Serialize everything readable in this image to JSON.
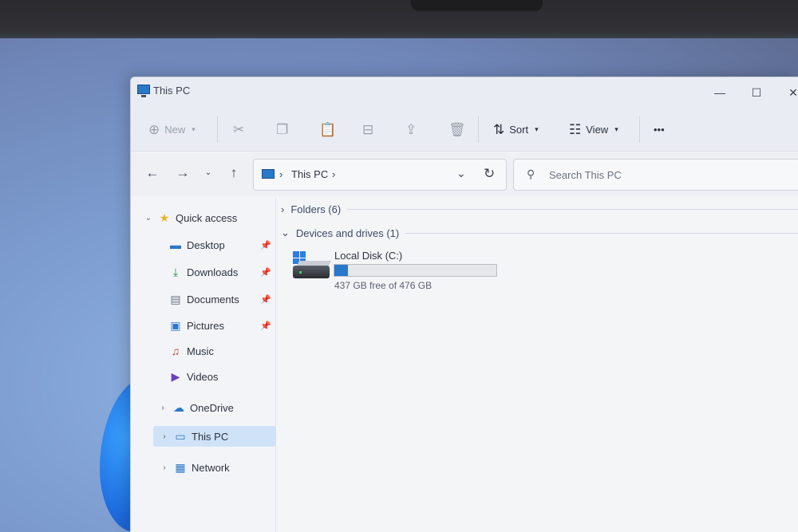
{
  "window": {
    "title": "This PC",
    "minimize": "—",
    "maximize": "☐",
    "close": "✕"
  },
  "toolbar": {
    "new_label": "New",
    "sort_label": "Sort",
    "view_label": "View",
    "more_label": "•••"
  },
  "address": {
    "location": "This PC"
  },
  "search": {
    "placeholder": "Search This PC"
  },
  "sidebar": {
    "items": [
      {
        "label": "Quick access"
      },
      {
        "label": "Desktop"
      },
      {
        "label": "Downloads"
      },
      {
        "label": "Documents"
      },
      {
        "label": "Pictures"
      },
      {
        "label": "Music"
      },
      {
        "label": "Videos"
      },
      {
        "label": "OneDrive"
      },
      {
        "label": "This PC"
      },
      {
        "label": "Network"
      }
    ]
  },
  "content": {
    "folders_group": "Folders (6)",
    "devices_group": "Devices and drives (1)",
    "drive": {
      "name": "Local Disk (C:)",
      "free_text": "437 GB free of 476 GB",
      "used_fraction": 0.082
    }
  },
  "colors": {
    "accent": "#2a78c8",
    "selected_bg": "#cfe2f7"
  }
}
